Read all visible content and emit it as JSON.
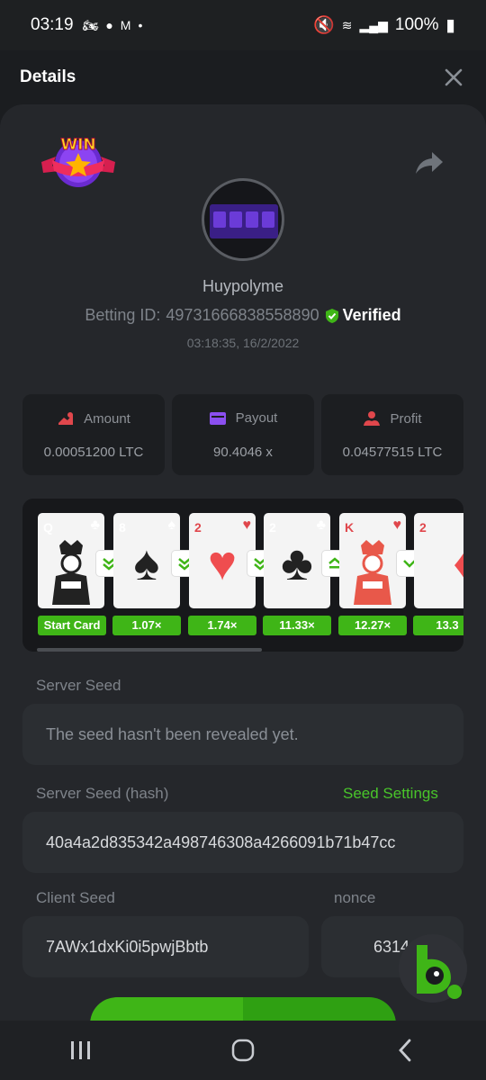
{
  "status_bar": {
    "time": "03:19",
    "battery": "100%"
  },
  "header": {
    "title": "Details",
    "close_icon": "close-icon"
  },
  "bet": {
    "username": "Huypolyme",
    "betting_id_label": "Betting ID:",
    "betting_id": "49731666838558890",
    "verified_label": "Verified",
    "datetime": "03:18:35, 16/2/2022",
    "badge_text": "WIN"
  },
  "stats": [
    {
      "label": "Amount",
      "value": "0.00051200 LTC",
      "icon": "amount-icon",
      "color": "#e0474c"
    },
    {
      "label": "Payout",
      "value": "90.4046 x",
      "icon": "wallet-icon",
      "color": "#8b4ff0"
    },
    {
      "label": "Profit",
      "value": "0.04577515 LTC",
      "icon": "profit-icon",
      "color": "#e0474c"
    }
  ],
  "cards": [
    {
      "rank": "Q",
      "suit": "♣",
      "color": "#111",
      "face": "king-figure",
      "multiplier": "Start Card",
      "next": "down"
    },
    {
      "rank": "8",
      "suit": "♠",
      "color": "#111",
      "face": "♠",
      "multiplier": "1.07×",
      "next": "down"
    },
    {
      "rank": "2",
      "suit": "♥",
      "color": "#e0474c",
      "face": "♥",
      "multiplier": "1.74×",
      "next": "down"
    },
    {
      "rank": "2",
      "suit": "♣",
      "color": "#111",
      "face": "♣",
      "multiplier": "11.33×",
      "next": "up"
    },
    {
      "rank": "K",
      "suit": "♥",
      "color": "#e0474c",
      "face": "king-figure",
      "multiplier": "12.27×",
      "next": "down"
    },
    {
      "rank": "2",
      "suit": "♦",
      "color": "#e0474c",
      "face": "♦",
      "multiplier": "13.3",
      "next": "none"
    }
  ],
  "seeds": {
    "server_seed_label": "Server Seed",
    "server_seed_value": "The seed hasn't been revealed yet.",
    "server_hash_label": "Server Seed (hash)",
    "seed_settings_link": "Seed Settings",
    "server_hash_value": "40a4a2d835342a498746308a4266091b71b47cc",
    "client_seed_label": "Client Seed",
    "client_seed_value": "7AWx1dxKi0i5pwjBbtb",
    "nonce_label": "nonce",
    "nonce_value": "6314"
  },
  "colors": {
    "accent": "#3fb517",
    "background": "#25272b"
  }
}
